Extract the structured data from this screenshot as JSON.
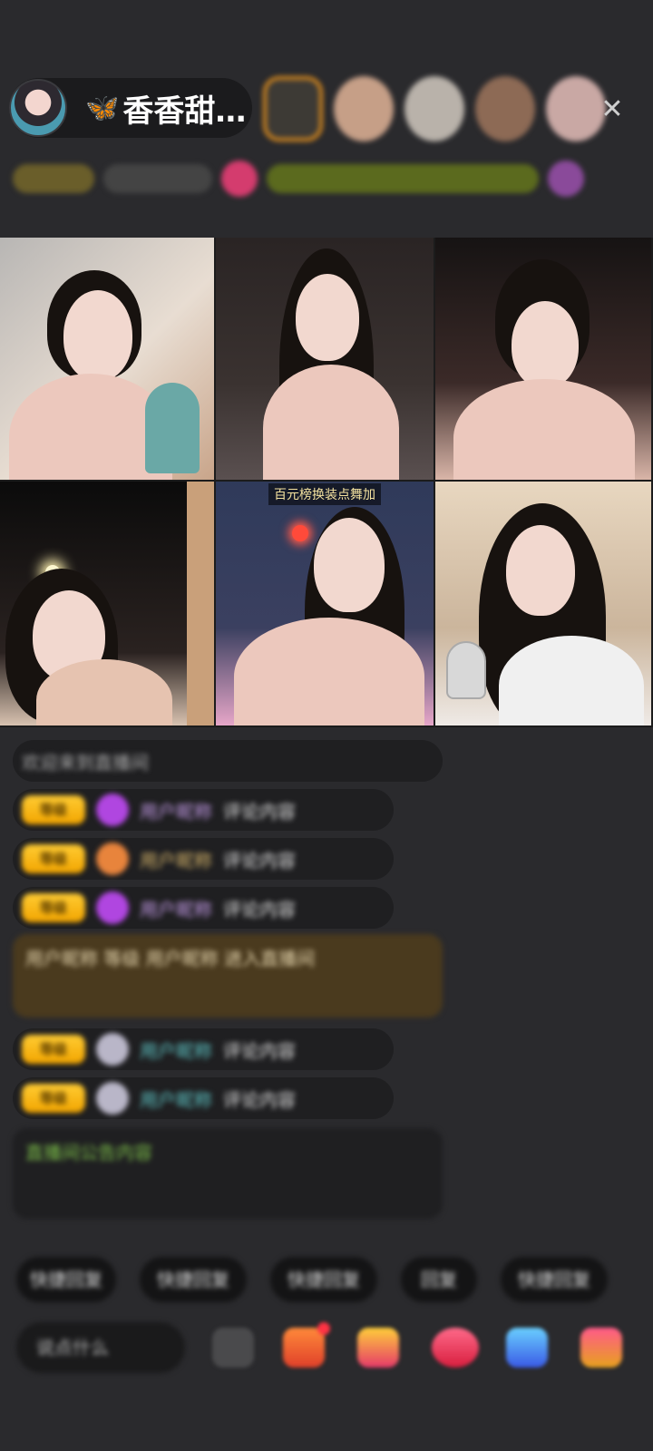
{
  "host": {
    "name": "香香甜…",
    "badge_icon": "butterfly-icon"
  },
  "viewers": [
    "viewer-1",
    "viewer-2",
    "viewer-3",
    "viewer-4",
    "viewer-5"
  ],
  "close_icon": "✕",
  "stream_grid": {
    "tiles": [
      {
        "id": "t1",
        "caption": ""
      },
      {
        "id": "t2",
        "caption": ""
      },
      {
        "id": "t3",
        "caption": ""
      },
      {
        "id": "t4",
        "caption": ""
      },
      {
        "id": "t5",
        "caption": "百元榜换装点舞加"
      },
      {
        "id": "t6",
        "caption": ""
      }
    ]
  },
  "chat": {
    "system_line": "欢迎来到直播间",
    "messages": [
      {
        "level": "等级",
        "nick": "用户昵称",
        "text": "评论内容"
      },
      {
        "level": "等级",
        "nick": "用户昵称",
        "text": "评论内容"
      },
      {
        "level": "等级",
        "nick": "用户昵称",
        "text": "评论内容"
      },
      {
        "level": "等级",
        "nick": "用户昵称",
        "text": "评论内容"
      },
      {
        "level": "等级",
        "nick": "用户昵称",
        "text": "评论内容"
      }
    ],
    "highlight": {
      "text": "用户昵称  等级  用户昵称  进入直播间"
    },
    "announcement": "直播间公告内容"
  },
  "quick_replies": [
    "快捷回复",
    "快捷回复",
    "快捷回复",
    "回复",
    "快捷回复"
  ],
  "bottom_bar": {
    "say_placeholder": "说点什么",
    "icons": [
      "emoji-icon",
      "gift-box-icon",
      "treasure-icon",
      "heart-icon",
      "share-icon",
      "more-icon"
    ]
  },
  "colors": {
    "background": "#2a2a2d",
    "level_badge": "#f2a500",
    "highlight_bg": "#4a3a1e",
    "notice_green": "#7ec24a"
  }
}
